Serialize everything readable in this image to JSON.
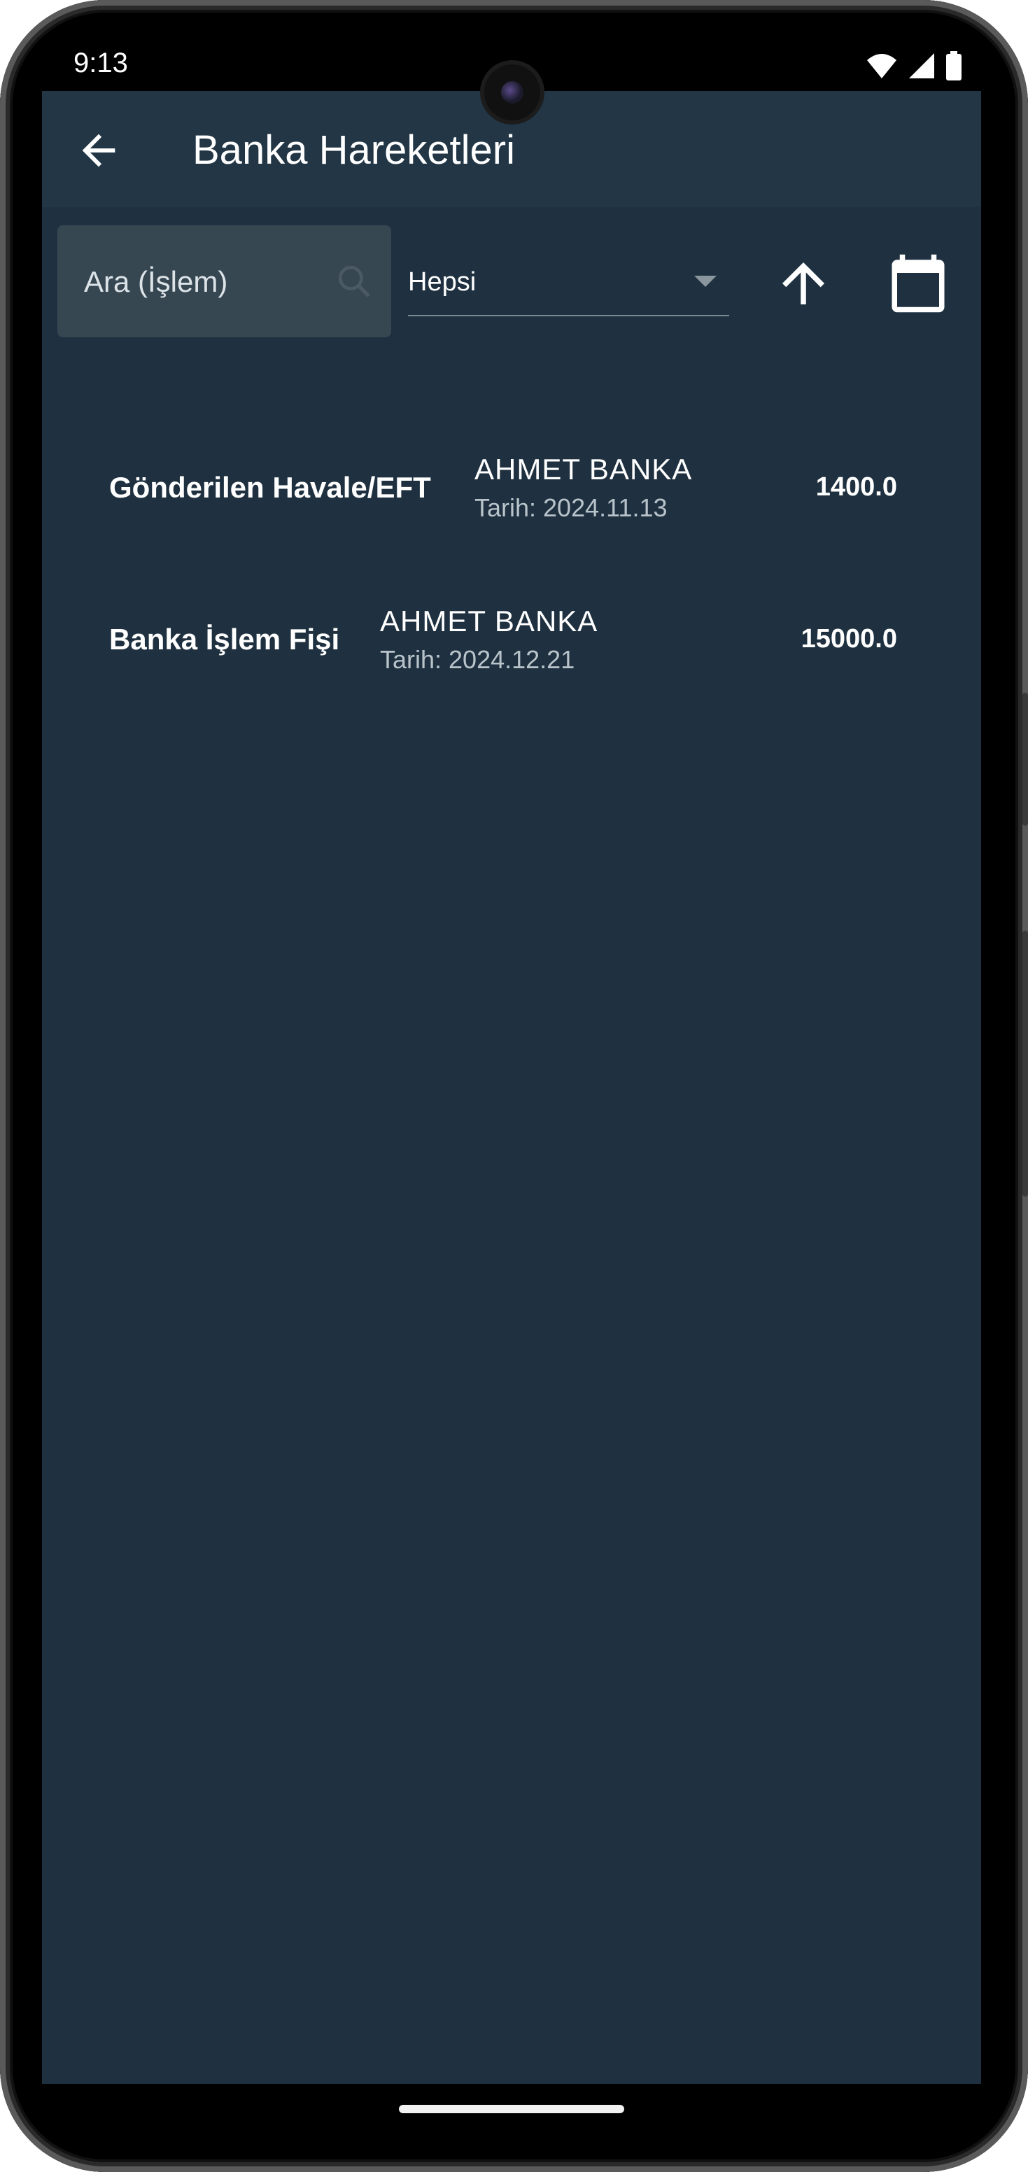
{
  "status_bar": {
    "time": "9:13",
    "icons": [
      "wifi-icon",
      "cellular-signal-icon",
      "battery-icon"
    ]
  },
  "app_bar": {
    "title": "Banka Hareketleri",
    "back_icon": "arrow-left-icon"
  },
  "filters": {
    "search_placeholder": "Ara (İşlem)",
    "search_value": "",
    "type_filter_selected": "Hepsi",
    "sort_icon": "arrow-up-icon",
    "date_icon": "calendar-icon"
  },
  "transactions": [
    {
      "type": "Gönderilen Havale/EFT",
      "bank": "AHMET BANKA",
      "date": "Tarih: 2024.11.13",
      "amount": "1400.0"
    },
    {
      "type": "Banka İşlem Fişi",
      "bank": "AHMET BANKA",
      "date": "Tarih: 2024.12.21",
      "amount": "15000.0"
    }
  ],
  "colors": {
    "background": "#1f3140",
    "app_bar": "#223645",
    "search_field": "#374752",
    "text_primary": "#ffffff",
    "text_secondary": "#b9c3ca"
  }
}
